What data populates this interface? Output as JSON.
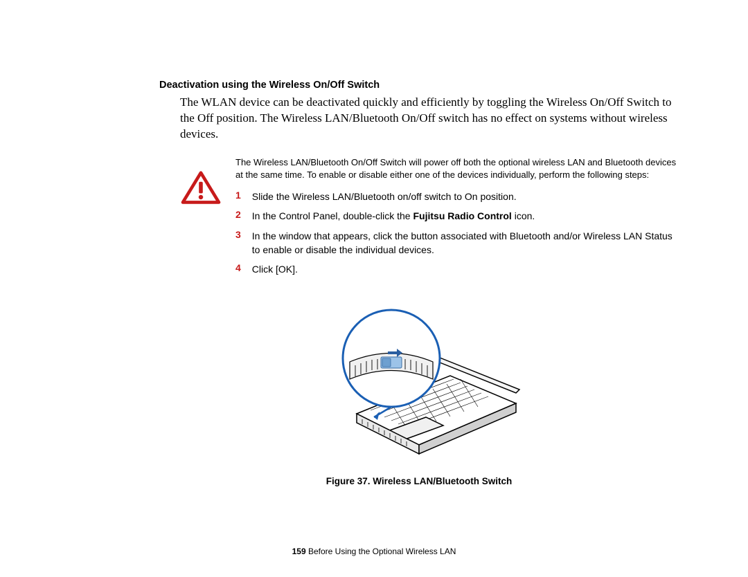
{
  "section": {
    "title": "Deactivation using the Wireless On/Off Switch",
    "body": "The WLAN device can be deactivated quickly and efficiently by toggling the Wireless On/Off Switch to the Off position. The Wireless LAN/Bluetooth On/Off switch has no effect on systems without wireless devices."
  },
  "warning": {
    "intro": "The Wireless LAN/Bluetooth On/Off Switch will power off both the optional wireless LAN and Bluetooth devices at the same time. To enable or disable either one of the devices individually, perform the following steps:",
    "steps": [
      {
        "num": "1",
        "text_before": "Slide the Wireless LAN/Bluetooth on/off switch to On position.",
        "bold": "",
        "text_after": ""
      },
      {
        "num": "2",
        "text_before": "In the Control Panel, double-click the ",
        "bold": "Fujitsu Radio Control",
        "text_after": " icon."
      },
      {
        "num": "3",
        "text_before": "In the window that appears, click the button associated with Bluetooth and/or Wireless LAN Status to enable or disable the individual devices.",
        "bold": "",
        "text_after": ""
      },
      {
        "num": "4",
        "text_before": "Click [OK].",
        "bold": "",
        "text_after": ""
      }
    ]
  },
  "figure": {
    "caption": "Figure 37.  Wireless LAN/Bluetooth Switch"
  },
  "footer": {
    "page_num": "159",
    "text": " Before Using the Optional Wireless LAN"
  },
  "colors": {
    "accent_red": "#c71a1a",
    "callout_blue": "#1a5fb4"
  }
}
